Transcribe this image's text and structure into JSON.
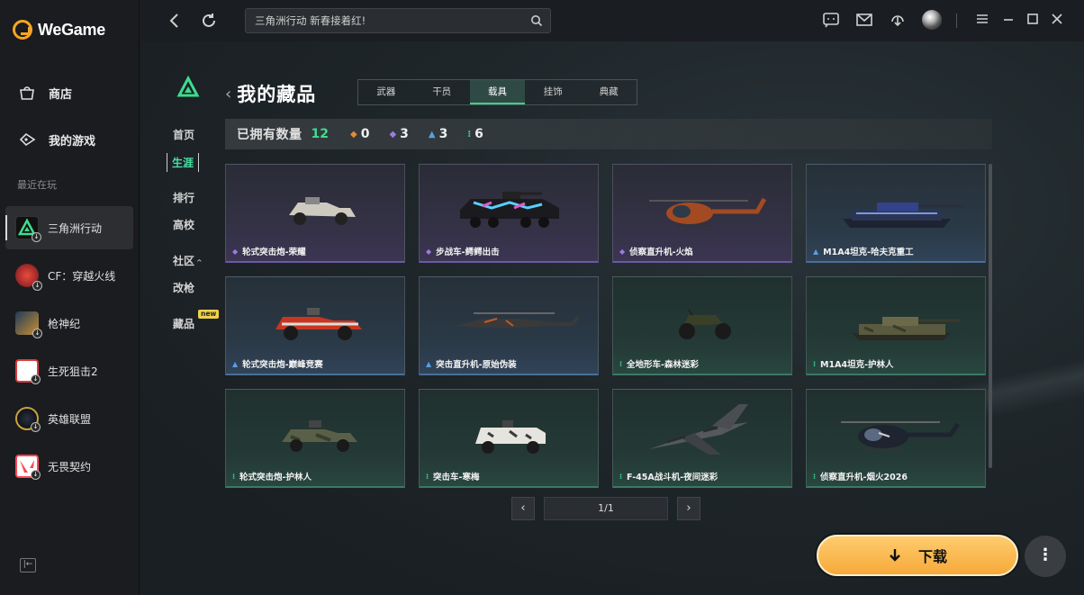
{
  "app": {
    "name": "WeGame"
  },
  "sidebar": {
    "nav": [
      {
        "label": "商店",
        "icon": "shop-bag-icon"
      },
      {
        "label": "我的游戏",
        "icon": "gamepad-icon"
      }
    ],
    "recent_label": "最近在玩",
    "games": [
      {
        "label": "三角洲行动",
        "active": true
      },
      {
        "label": "CF：穿越火线"
      },
      {
        "label": "枪神纪"
      },
      {
        "label": "生死狙击2"
      },
      {
        "label": "英雄联盟"
      },
      {
        "label": "无畏契约"
      }
    ]
  },
  "topbar": {
    "search_placeholder": "三角洲行动 新春接着红!"
  },
  "subnav": {
    "items": [
      "首页",
      "生涯",
      "排行",
      "高校",
      "社区",
      "改枪",
      "藏品"
    ],
    "community_suffix": "^",
    "new_badge": "new",
    "active": "生涯"
  },
  "page": {
    "title": "我的藏品",
    "tabs": [
      "武器",
      "干员",
      "载具",
      "挂饰",
      "典藏"
    ],
    "active_tab": "载具",
    "owned_label": "已拥有数量",
    "owned_count": "12",
    "rarity_counts": [
      {
        "gem": "◆",
        "color": "#e08a3a",
        "value": "0"
      },
      {
        "gem": "◆",
        "color": "#9b7be0",
        "value": "3"
      },
      {
        "gem": "▲",
        "color": "#5b9ee0",
        "value": "3"
      },
      {
        "gem": "⁝",
        "color": "#3fcf8e",
        "value": "6"
      }
    ]
  },
  "items": [
    {
      "label": "轮式突击炮-荣耀",
      "rarity": "purple"
    },
    {
      "label": "步战车-鳄鳄出击",
      "rarity": "purple"
    },
    {
      "label": "侦察直升机-火焰",
      "rarity": "purple"
    },
    {
      "label": "M1A4坦克-哈夫克重工",
      "rarity": "blue"
    },
    {
      "label": "轮式突击炮-巅峰竞赛",
      "rarity": "blue"
    },
    {
      "label": "突击直升机-原始伪装",
      "rarity": "blue"
    },
    {
      "label": "全地形车-森林迷彩",
      "rarity": "green"
    },
    {
      "label": "M1A4坦克-护林人",
      "rarity": "green"
    },
    {
      "label": "轮式突击炮-护林人",
      "rarity": "green"
    },
    {
      "label": "突击车-寒梅",
      "rarity": "green"
    },
    {
      "label": "F-45A战斗机-夜间迷彩",
      "rarity": "green"
    },
    {
      "label": "侦察直升机-烟火2026",
      "rarity": "green"
    }
  ],
  "pager": {
    "text": "1/1"
  },
  "actions": {
    "download_label": "下载",
    "more_label": "⋮"
  },
  "colors": {
    "accent": "#3fdc8f",
    "download": "#f6a93a"
  }
}
